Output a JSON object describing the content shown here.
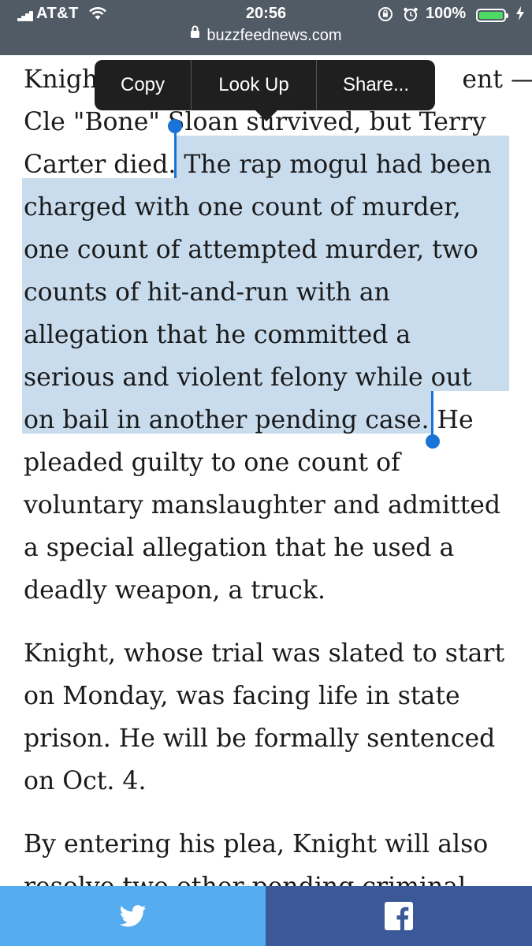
{
  "status_bar": {
    "carrier": "AT&T",
    "time": "20:56",
    "battery_percent": "100%",
    "battery_level": 1.0
  },
  "url_bar": {
    "domain": "buzzfeednews.com"
  },
  "edit_menu": {
    "items": [
      "Copy",
      "Look Up",
      "Share..."
    ]
  },
  "article": {
    "paragraphs": [
      {
        "lines": [
          [
            "Knigh",
            "",
            "",
            "ent —"
          ],
          [
            "Cle \"Bone\" Sloan survived, but Terry"
          ],
          [
            "Carter died. ",
            "The rap mogul had been"
          ],
          [
            "charged with one count of murder,"
          ],
          [
            "one count of attempted murder, two"
          ],
          [
            "counts of hit-and-run with an"
          ],
          [
            "allegation that he committed a"
          ],
          [
            "serious and violent felony while out"
          ],
          [
            "on bail in another pending case.",
            " He"
          ],
          [
            "pleaded guilty to one count of"
          ],
          [
            "voluntary manslaughter and admitted"
          ],
          [
            "a special allegation that he used a"
          ],
          [
            "deadly weapon, a truck."
          ]
        ]
      },
      {
        "lines": [
          [
            "Knight, whose trial was slated to start"
          ],
          [
            "on Monday, was facing life in state"
          ],
          [
            "prison. He will be formally sentenced"
          ],
          [
            "on Oct. 4."
          ]
        ]
      },
      {
        "lines": [
          [
            "By entering his plea, Knight will also"
          ],
          [
            "resolve two other pending criminal"
          ]
        ]
      }
    ]
  },
  "share_bar": {
    "twitter_color": "#55acee",
    "facebook_color": "#3b5998"
  },
  "colors": {
    "topbar": "#505b66",
    "selection": "#c9dcee",
    "handle": "#1a73d6"
  },
  "icons": [
    "signal-bars-icon",
    "wifi-icon",
    "rotation-lock-icon",
    "alarm-icon",
    "battery-icon",
    "charging-bolt-icon",
    "lock-icon",
    "twitter-icon",
    "facebook-icon"
  ]
}
